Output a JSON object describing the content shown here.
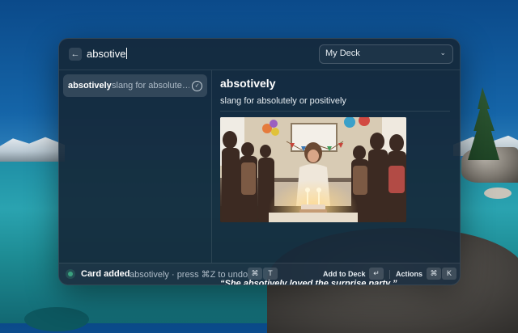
{
  "search": {
    "query": "absotive"
  },
  "deck": {
    "selected": "My Deck"
  },
  "results": [
    {
      "word": "absotively",
      "definition": "slang for absolute…"
    }
  ],
  "detail": {
    "term": "absotively",
    "definition": "slang for absolutely or positively",
    "example": "“She absotively loved the surprise party.”"
  },
  "status": {
    "title": "Card added",
    "detail": "absotively · press ⌘Z to undo",
    "undo_keys": [
      "⌘",
      "T"
    ]
  },
  "actions": {
    "add_label": "Add to Deck",
    "add_key": "↵",
    "actions_label": "Actions",
    "actions_keys": [
      "⌘",
      "K"
    ]
  },
  "icons": {
    "back": "arrow-left-icon",
    "chevron": "chevron-down-icon",
    "check": "check-circle-icon"
  },
  "colors": {
    "window_bg": "#15283a",
    "status_dot": "#3aa17e"
  }
}
